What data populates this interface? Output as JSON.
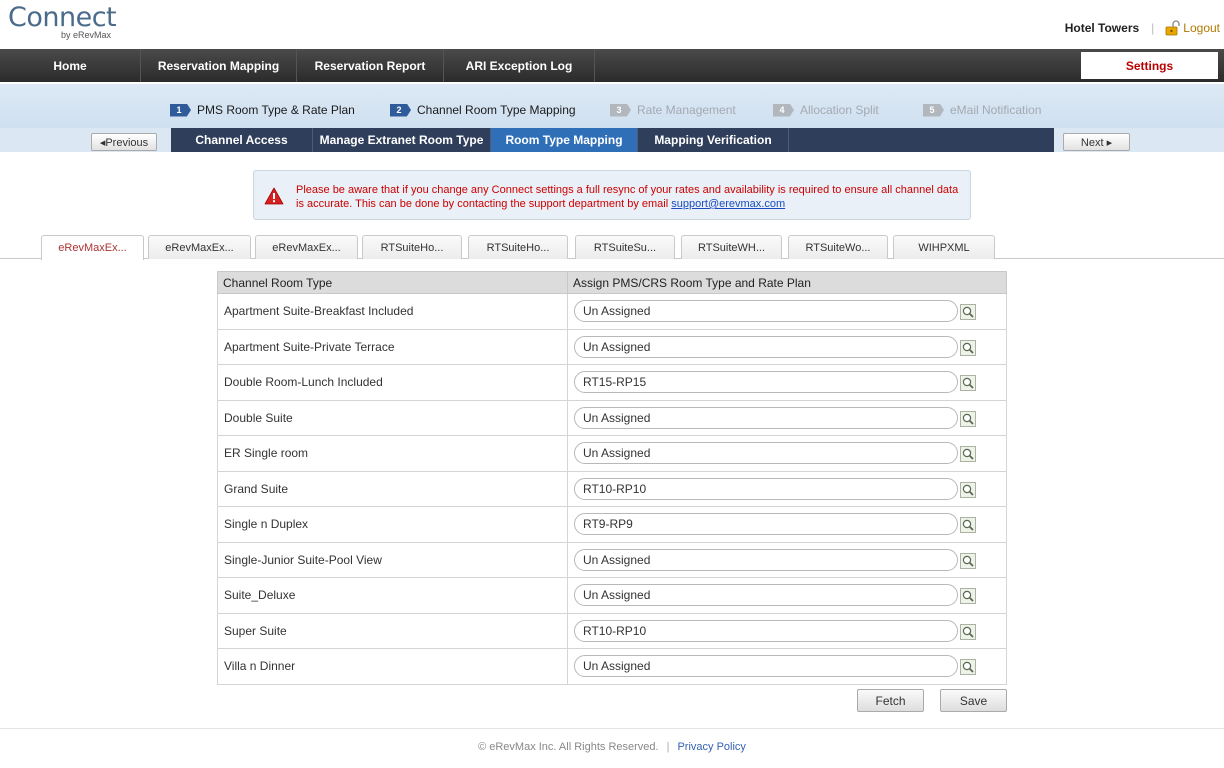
{
  "header": {
    "logo": "Connect",
    "logo_sub": "by eRevMax",
    "hotel_name": "Hotel Towers",
    "logout_label": "Logout"
  },
  "mainnav": {
    "items": [
      "Home",
      "Reservation Mapping",
      "Reservation Report",
      "ARI Exception Log"
    ],
    "settings_label": "Settings"
  },
  "steps": [
    {
      "num": "1",
      "label": "PMS Room Type & Rate Plan",
      "state": "active"
    },
    {
      "num": "2",
      "label": "Channel Room Type Mapping",
      "state": "active"
    },
    {
      "num": "3",
      "label": "Rate Management",
      "state": "inactive"
    },
    {
      "num": "4",
      "label": "Allocation Split",
      "state": "inactive"
    },
    {
      "num": "5",
      "label": "eMail Notification",
      "state": "inactive"
    }
  ],
  "subnav": {
    "tabs": [
      "Channel Access",
      "Manage Extranet Room Type",
      "Room Type Mapping",
      "Mapping Verification"
    ],
    "active_tab": "Room Type Mapping",
    "previous_label": "◂Previous",
    "next_label": "Next ▸"
  },
  "alert": {
    "message": "Please be aware that if you change any Connect settings a full resync of your rates and availability is required to ensure all channel data is accurate. This can be done by contacting the support department by email ",
    "email": "support@erevmax.com"
  },
  "channel_tabs": {
    "items": [
      "eRevMaxEx...",
      "eRevMaxEx...",
      "eRevMaxEx...",
      "RTSuiteHo...",
      "RTSuiteHo...",
      "RTSuiteSu...",
      "RTSuiteWH...",
      "RTSuiteWo...",
      "WIHPXML"
    ],
    "active_index": 0
  },
  "table": {
    "headers": [
      "Channel Room Type",
      "Assign PMS/CRS Room Type and Rate Plan"
    ],
    "rows": [
      {
        "room_type": "Apartment Suite-Breakfast Included",
        "assigned": "Un Assigned"
      },
      {
        "room_type": "Apartment Suite-Private Terrace",
        "assigned": "Un Assigned"
      },
      {
        "room_type": "Double Room-Lunch Included",
        "assigned": "RT15-RP15"
      },
      {
        "room_type": "Double Suite",
        "assigned": "Un Assigned"
      },
      {
        "room_type": "ER Single room",
        "assigned": "Un Assigned"
      },
      {
        "room_type": "Grand Suite",
        "assigned": "RT10-RP10"
      },
      {
        "room_type": "Single n Duplex",
        "assigned": "RT9-RP9"
      },
      {
        "room_type": "Single-Junior Suite-Pool View",
        "assigned": "Un Assigned"
      },
      {
        "room_type": "Suite_Deluxe",
        "assigned": "Un Assigned"
      },
      {
        "room_type": "Super Suite",
        "assigned": "RT10-RP10"
      },
      {
        "room_type": "Villa n Dinner",
        "assigned": "Un Assigned"
      }
    ]
  },
  "actions": {
    "fetch_label": "Fetch",
    "save_label": "Save"
  },
  "footer": {
    "copyright": "© eRevMax Inc. All Rights Reserved.",
    "pipe": "|",
    "privacy_label": "Privacy Policy"
  },
  "colors": {
    "accent_blue": "#2f6fb8",
    "nav_dark": "#2f3e5a",
    "alert_red": "#cc0000",
    "settings_red": "#bb0000"
  }
}
